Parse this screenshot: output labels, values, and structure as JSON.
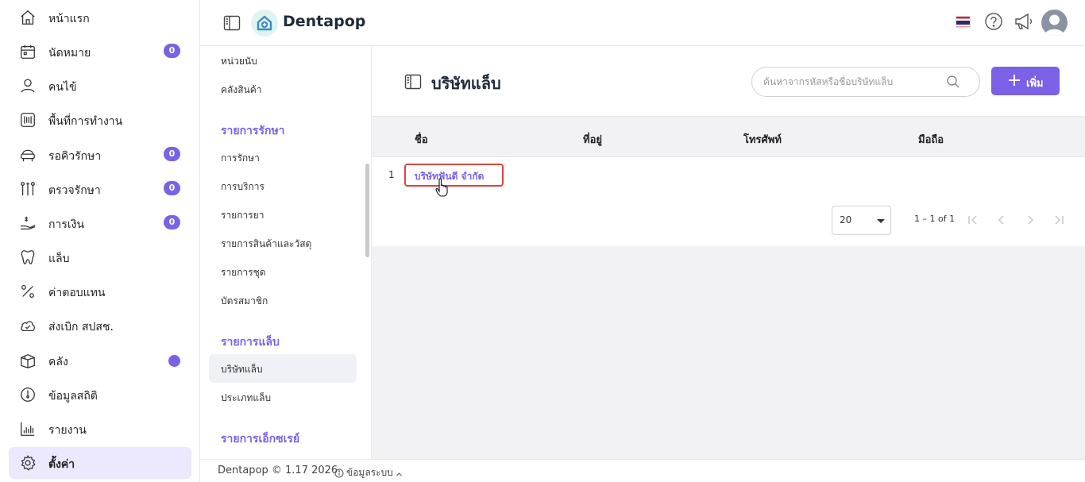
{
  "app": {
    "title": "Dentapop"
  },
  "sidebar": {
    "items": [
      {
        "label": "หน้าแรก",
        "icon": "home-icon"
      },
      {
        "label": "นัดหมาย",
        "icon": "calendar-icon",
        "badge": "0"
      },
      {
        "label": "คนไข้",
        "icon": "user-icon"
      },
      {
        "label": "พื้นที่การทำงาน",
        "icon": "workspace-icon"
      },
      {
        "label": "รอคิวรักษา",
        "icon": "dental-chair-icon",
        "badge": "0"
      },
      {
        "label": "ตรวจรักษา",
        "icon": "dental-tools-icon",
        "badge": "0"
      },
      {
        "label": "การเงิน",
        "icon": "money-hand-icon",
        "badge": "0"
      },
      {
        "label": "แล็บ",
        "icon": "tooth-icon"
      },
      {
        "label": "ค่าตอบแทน",
        "icon": "percent-icon"
      },
      {
        "label": "ส่งเบิก สปสช.",
        "icon": "cloud-icon"
      },
      {
        "label": "คลัง",
        "icon": "box-icon"
      },
      {
        "label": "ข้อมูลสถิติ",
        "icon": "gauge-icon"
      },
      {
        "label": "รายงาน",
        "icon": "bar-chart-icon"
      },
      {
        "label": "ตั้งค่า",
        "icon": "gear-icon"
      }
    ]
  },
  "submenu": {
    "groups": [
      {
        "items": [
          "หน่วยนับ",
          "คลังสินค้า"
        ]
      },
      {
        "title": "รายการรักษา",
        "items": [
          "การรักษา",
          "การบริการ",
          "รายการยา",
          "รายการสินค้าและวัสดุ",
          "รายการชุด",
          "บัตรสมาชิก"
        ]
      },
      {
        "title": "รายการแล็บ",
        "items": [
          "บริษัทแล็บ",
          "ประเภทแล็บ"
        ]
      },
      {
        "title": "รายการเอ็กซเรย์",
        "items": []
      }
    ]
  },
  "main": {
    "title": "บริษัทแล็บ",
    "search_placeholder": "ค้นหาจากรหัสหรือชื่อบริษัทแล็บ",
    "add_label": "เพิ่ม",
    "columns": [
      "ชื่อ",
      "ที่อยู่",
      "โทรศัพท์",
      "มือถือ"
    ],
    "rows": [
      {
        "index": "1",
        "name": "บริษัทฟันดี จำกัด",
        "address": "",
        "phone": "",
        "mobile": ""
      }
    ],
    "page_size": "20",
    "range": "1 – 1 of 1"
  },
  "footer": {
    "copyright": "Dentapop © 1.17 2026",
    "info": "ข้อมูลระบบ"
  },
  "colors": {
    "accent": "#7b61e6",
    "active_bg": "#ece8fd",
    "highlight_border": "#d9453f"
  }
}
